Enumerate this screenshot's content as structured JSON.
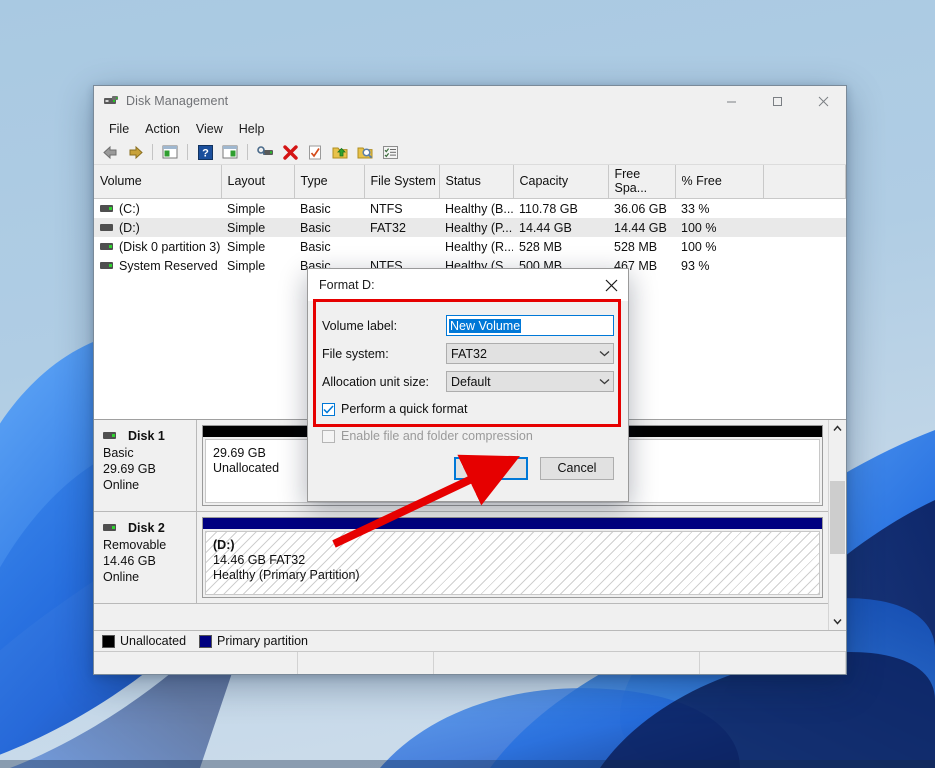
{
  "window": {
    "title": "Disk Management",
    "icon": "disk-management-icon",
    "controls": {
      "minimize": "minimize-icon",
      "maximize": "maximize-icon",
      "close": "close-icon"
    }
  },
  "menubar": {
    "items": [
      "File",
      "Action",
      "View",
      "Help"
    ]
  },
  "toolbar": {
    "items": [
      {
        "name": "back-icon"
      },
      {
        "name": "forward-icon"
      },
      {
        "name": "separator"
      },
      {
        "name": "show-hide-console-tree-icon"
      },
      {
        "name": "separator"
      },
      {
        "name": "help-icon"
      },
      {
        "name": "show-hide-action-pane-icon"
      },
      {
        "name": "separator"
      },
      {
        "name": "properties-icon"
      },
      {
        "name": "delete-icon"
      },
      {
        "name": "refresh-icon"
      },
      {
        "name": "rescan-disks-icon"
      },
      {
        "name": "all-tasks-icon"
      },
      {
        "name": "list-view-icon"
      }
    ]
  },
  "volume_list": {
    "columns": [
      "Volume",
      "Layout",
      "Type",
      "File System",
      "Status",
      "Capacity",
      "Free Spa...",
      "% Free",
      ""
    ],
    "rows": [
      {
        "volume": "(C:)",
        "layout": "Simple",
        "type": "Basic",
        "filesystem": "NTFS",
        "status": "Healthy (B...",
        "capacity": "110.78 GB",
        "free": "36.06 GB",
        "pctfree": "33 %",
        "selected": false,
        "online": true
      },
      {
        "volume": "(D:)",
        "layout": "Simple",
        "type": "Basic",
        "filesystem": "FAT32",
        "status": "Healthy (P...",
        "capacity": "14.44 GB",
        "free": "14.44 GB",
        "pctfree": "100 %",
        "selected": true,
        "online": false
      },
      {
        "volume": "(Disk 0 partition 3)",
        "layout": "Simple",
        "type": "Basic",
        "filesystem": "",
        "status": "Healthy (R...",
        "capacity": "528 MB",
        "free": "528 MB",
        "pctfree": "100 %",
        "selected": false,
        "online": true
      },
      {
        "volume": "System Reserved",
        "layout": "Simple",
        "type": "Basic",
        "filesystem": "NTFS",
        "status": "Healthy (S...",
        "capacity": "500 MB",
        "free": "467 MB",
        "pctfree": "93 %",
        "selected": false,
        "online": true
      }
    ]
  },
  "disks": [
    {
      "name": "Disk 1",
      "type": "Basic",
      "size": "29.69 GB",
      "state": "Online",
      "partition": {
        "kind": "unallocated",
        "line1": "29.69 GB",
        "line2": "Unallocated",
        "line3": ""
      }
    },
    {
      "name": "Disk 2",
      "type": "Removable",
      "size": "14.46 GB",
      "state": "Online",
      "partition": {
        "kind": "primary",
        "line1": "(D:)",
        "line2": "14.46 GB FAT32",
        "line3": "Healthy (Primary Partition)"
      }
    }
  ],
  "legend": [
    {
      "label": "Unallocated",
      "color": "#000000"
    },
    {
      "label": "Primary partition",
      "color": "#000080"
    }
  ],
  "dialog": {
    "title": "Format D:",
    "close_icon": "close-icon",
    "fields": [
      {
        "label": "Volume label:",
        "kind": "text",
        "value": "New Volume",
        "selected": true
      },
      {
        "label": "File system:",
        "kind": "select",
        "value": "FAT32"
      },
      {
        "label": "Allocation unit size:",
        "kind": "select",
        "value": "Default"
      }
    ],
    "checkboxes": [
      {
        "label": "Perform a quick format",
        "checked": true,
        "enabled": true
      },
      {
        "label": "Enable file and folder compression",
        "checked": false,
        "enabled": false
      }
    ],
    "buttons": {
      "ok": "OK",
      "cancel": "Cancel"
    }
  },
  "annotations": {
    "highlight_color": "#e60000",
    "arrow_color": "#e60000"
  },
  "colors": {
    "accent": "#0078d7",
    "primary_partition": "#000080",
    "unallocated": "#000000",
    "desktop": "#b2cde3"
  }
}
